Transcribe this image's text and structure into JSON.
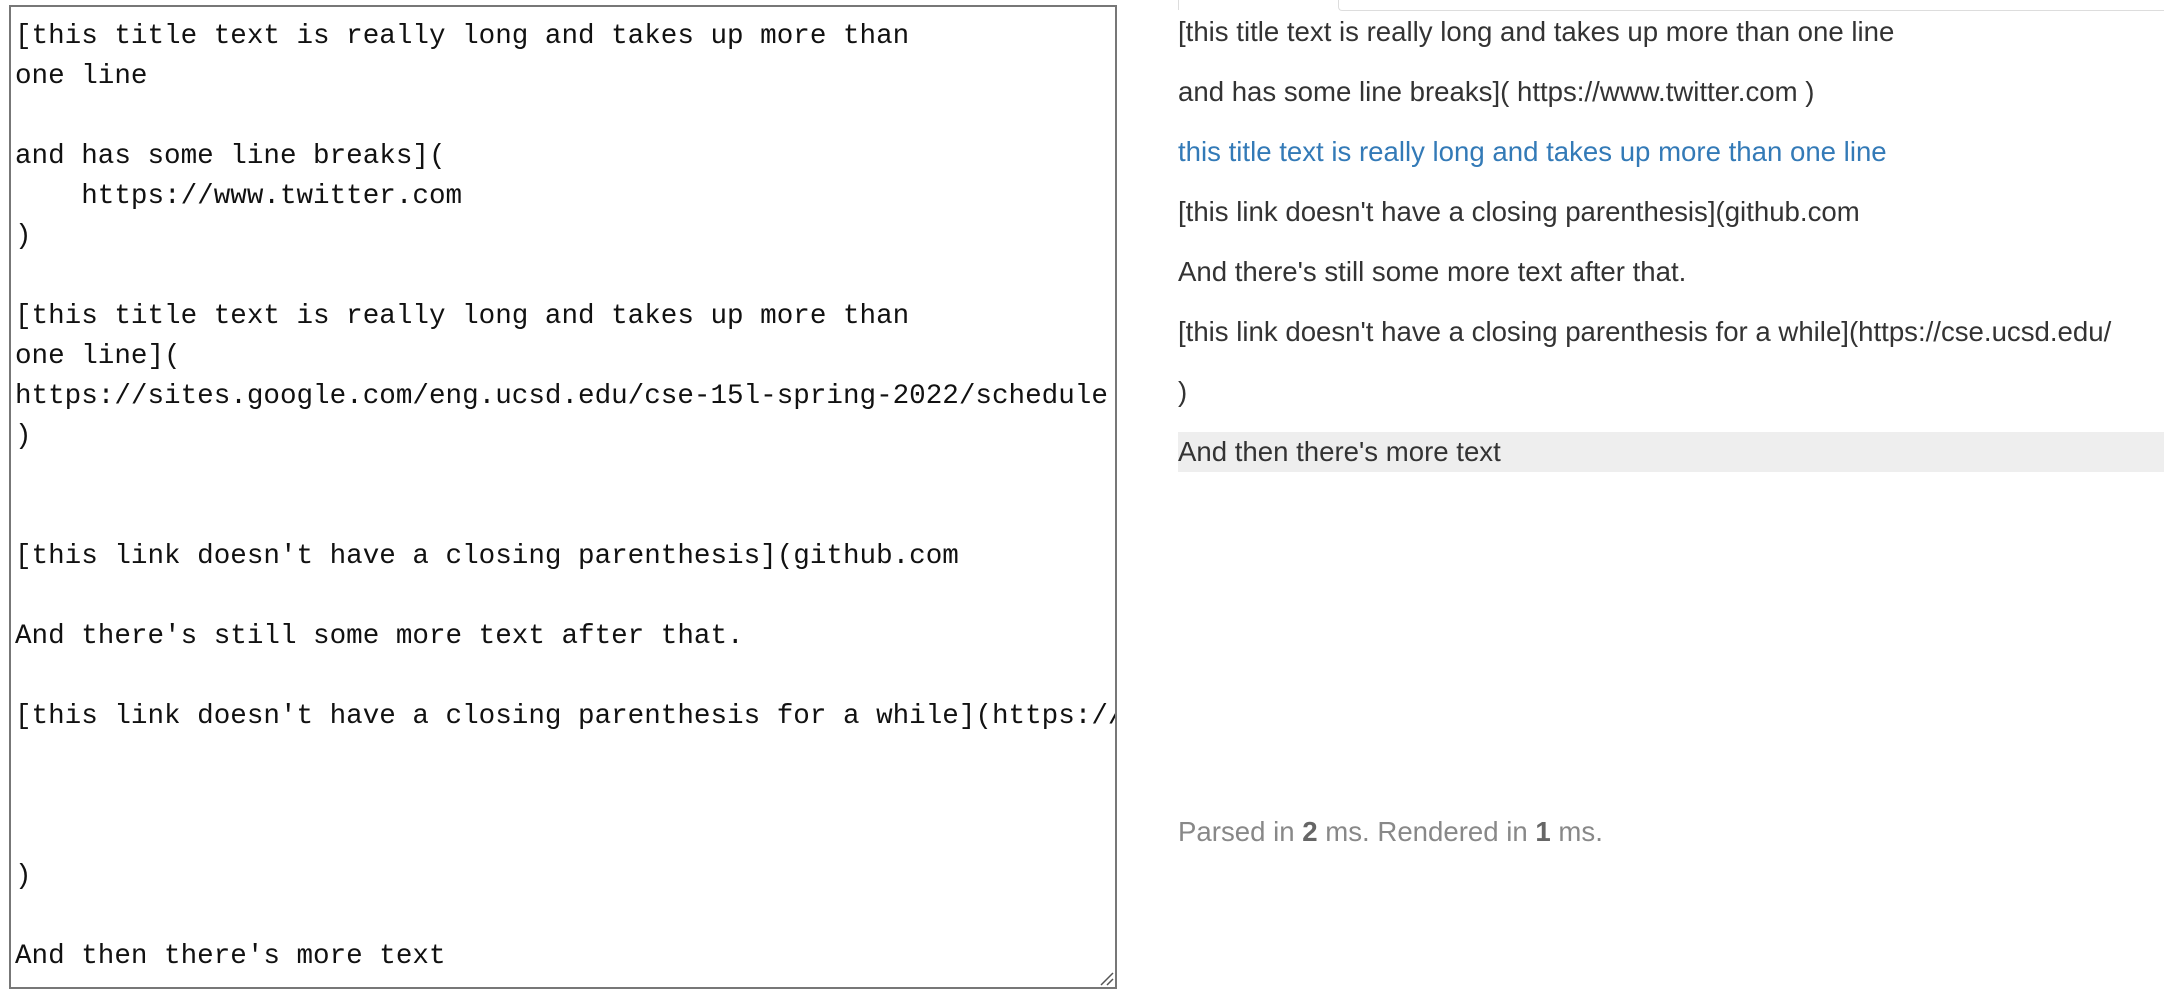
{
  "editor": {
    "source": "[this title text is really long and takes up more than\none line\n\nand has some line breaks](\n    https://www.twitter.com\n)\n\n[this title text is really long and takes up more than\none line](\nhttps://sites.google.com/eng.ucsd.edu/cse-15l-spring-2022/schedule\n)\n\n\n[this link doesn't have a closing parenthesis](github.com\n\nAnd there's still some more text after that.\n\n[this link doesn't have a closing parenthesis for a while](https://cse.ucsd.edu/\n\n\n\n)\n\nAnd then there's more text"
  },
  "preview": {
    "paragraphs": [
      "[this title text is really long and takes up more than one line",
      "and has some line breaks]( https://www.twitter.com )",
      "",
      "[this link doesn't have a closing parenthesis](github.com",
      "And there's still some more text after that.",
      "[this link doesn't have a closing parenthesis for a while](https://cse.ucsd.edu/",
      ")",
      "And then there's more text"
    ],
    "link_text": "this title text is really long and takes up more than one line",
    "link_href": "https://sites.google.com/eng.ucsd.edu/cse-15l-spring-2022/schedule"
  },
  "stats": {
    "parsed_prefix": "Parsed in ",
    "parsed_ms": "2",
    "parsed_suffix": " ms. Rendered in ",
    "rendered_ms": "1",
    "rendered_suffix": " ms."
  },
  "colors": {
    "link": "#337ab7",
    "text": "#333333",
    "stats": "#888888",
    "highlight": "#eeeeee"
  }
}
